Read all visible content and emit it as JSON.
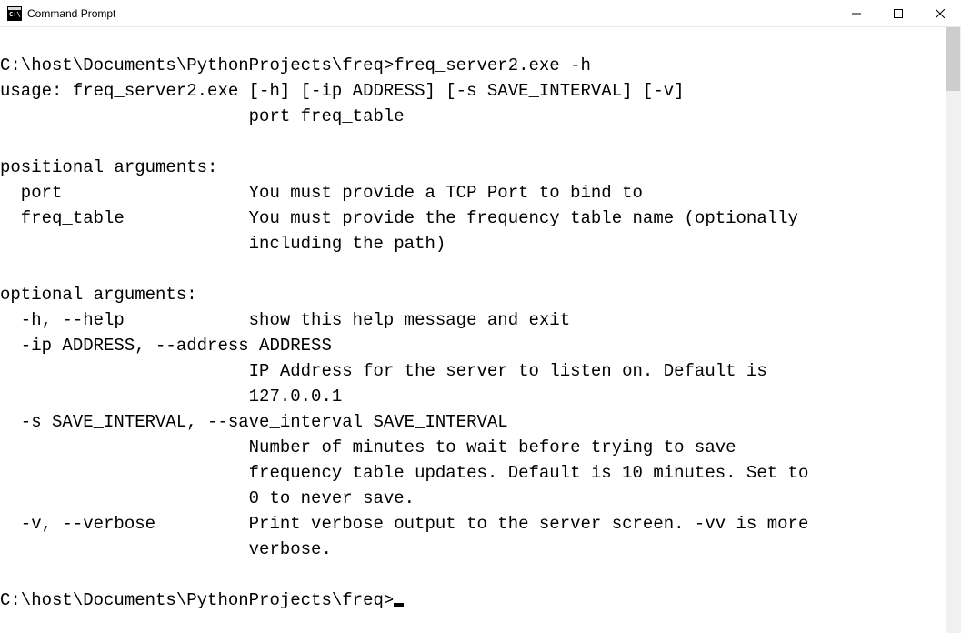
{
  "window": {
    "title": "Command Prompt"
  },
  "terminal": {
    "line1": "",
    "line2": "C:\\host\\Documents\\PythonProjects\\freq>freq_server2.exe -h",
    "line3": "usage: freq_server2.exe [-h] [-ip ADDRESS] [-s SAVE_INTERVAL] [-v]",
    "line4": "                        port freq_table",
    "line5": "",
    "line6": "positional arguments:",
    "line7": "  port                  You must provide a TCP Port to bind to",
    "line8": "  freq_table            You must provide the frequency table name (optionally",
    "line9": "                        including the path)",
    "line10": "",
    "line11": "optional arguments:",
    "line12": "  -h, --help            show this help message and exit",
    "line13": "  -ip ADDRESS, --address ADDRESS",
    "line14": "                        IP Address for the server to listen on. Default is",
    "line15": "                        127.0.0.1",
    "line16": "  -s SAVE_INTERVAL, --save_interval SAVE_INTERVAL",
    "line17": "                        Number of minutes to wait before trying to save",
    "line18": "                        frequency table updates. Default is 10 minutes. Set to",
    "line19": "                        0 to never save.",
    "line20": "  -v, --verbose         Print verbose output to the server screen. -vv is more",
    "line21": "                        verbose.",
    "line22": "",
    "prompt": "C:\\host\\Documents\\PythonProjects\\freq>"
  }
}
